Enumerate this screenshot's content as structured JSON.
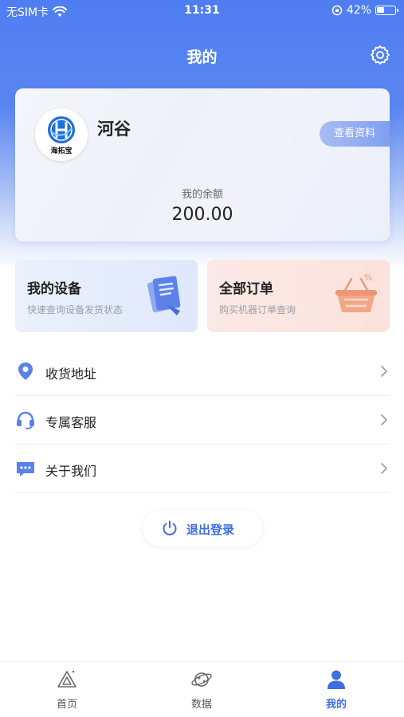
{
  "status_bar": {
    "carrier": "无SIM卡",
    "time": "11:31",
    "battery_percent": "42%",
    "battery_level": 0.42
  },
  "nav": {
    "title": "我的"
  },
  "profile": {
    "avatar_caption": "海拓宝",
    "name": "河谷",
    "view_profile_label": "查看资料",
    "balance_label": "我的余额",
    "balance_value": "200.00"
  },
  "feature_cards": [
    {
      "title": "我的设备",
      "subtitle": "快速查询设备发货状态",
      "icon": "device-document-icon"
    },
    {
      "title": "全部订单",
      "subtitle": "购买机器订单查询",
      "icon": "shopping-basket-icon"
    }
  ],
  "menu": [
    {
      "label": "收货地址",
      "icon": "location-pin-icon"
    },
    {
      "label": "专属客服",
      "icon": "headset-icon"
    },
    {
      "label": "关于我们",
      "icon": "chat-bubble-icon"
    }
  ],
  "logout": {
    "label": "退出登录"
  },
  "tabs": [
    {
      "label": "首页",
      "icon": "home-triangle-icon",
      "active": false
    },
    {
      "label": "数据",
      "icon": "planet-icon",
      "active": false
    },
    {
      "label": "我的",
      "icon": "user-icon",
      "active": true
    }
  ],
  "colors": {
    "brand_blue": "#4f7ef2",
    "active_tab": "#3f6fe0",
    "card_devices_bg": "#e4ecfb",
    "card_orders_bg": "#fbe5df"
  }
}
